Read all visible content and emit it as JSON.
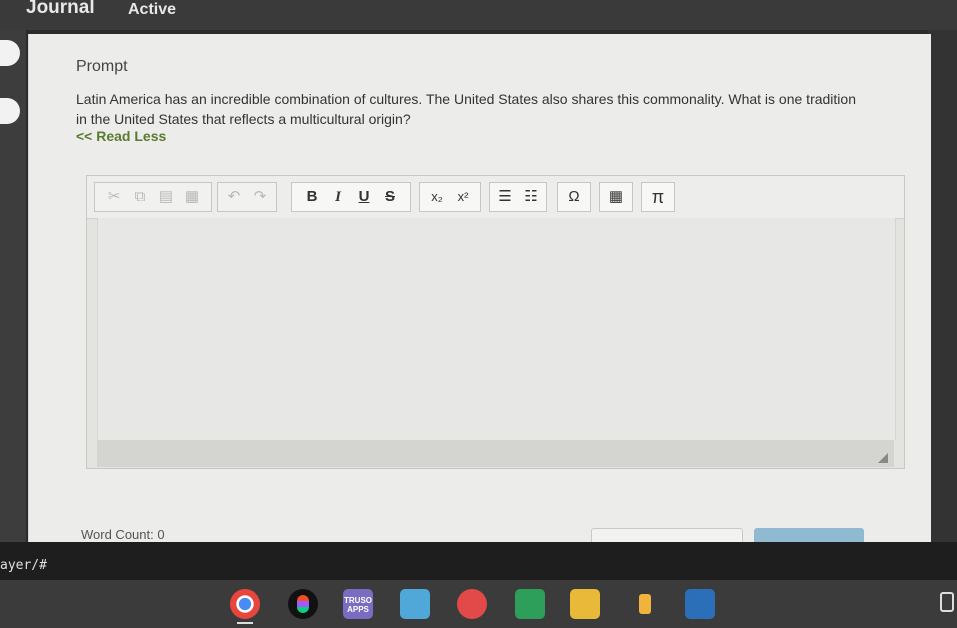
{
  "header": {
    "title": "Journal",
    "status": "Active"
  },
  "prompt": {
    "label": "Prompt",
    "text": "Latin America has an incredible combination of cultures. The United States also shares this commonality. What is one tradition in the United States that reflects a multicultural origin?",
    "read_less": "<< Read Less"
  },
  "toolbar": {
    "bold": "B",
    "italic": "I",
    "underline": "U",
    "strikethrough": "S",
    "subscript": "x₂",
    "superscript": "x²",
    "special_char": "Ω",
    "pi": "π"
  },
  "footer": {
    "word_count": "Word Count: 0"
  },
  "url_fragment": "ayer/#",
  "shelf_apps": [
    {
      "name": "chrome"
    },
    {
      "name": "figma"
    },
    {
      "name": "truso-apps",
      "label": "TRUSO APPS"
    },
    {
      "name": "keyboard-app"
    },
    {
      "name": "paint-app"
    },
    {
      "name": "classroom-app"
    },
    {
      "name": "slides-app"
    },
    {
      "name": "camera-app"
    },
    {
      "name": "screencast-app"
    }
  ],
  "colors": {
    "accent_link": "#5a7a2e",
    "submit_button": "#8fbad1",
    "panel_bg": "#ecedea"
  }
}
